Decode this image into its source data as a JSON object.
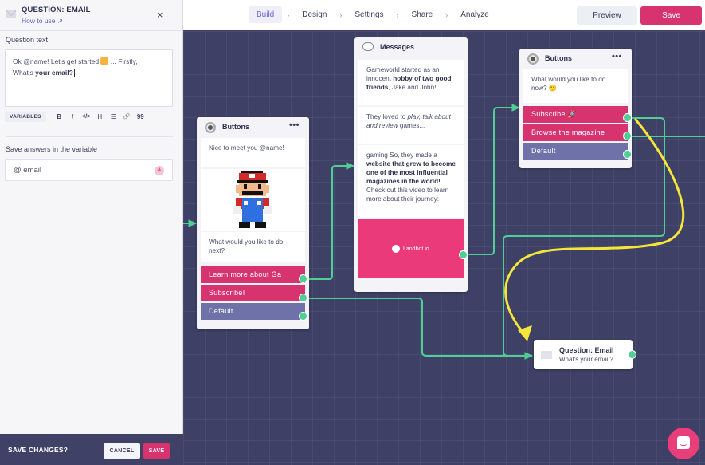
{
  "topbar": {
    "steps": [
      {
        "label": "Build",
        "active": true
      },
      {
        "label": "Design",
        "active": false
      },
      {
        "label": "Settings",
        "active": false
      },
      {
        "label": "Share",
        "active": false
      },
      {
        "label": "Analyze",
        "active": false
      }
    ],
    "step_separator": "›",
    "preview_label": "Preview",
    "save_label": "Save"
  },
  "panel": {
    "title": "QUESTION: EMAIL",
    "how_to_use": "How to use ↗",
    "close_icon": "×",
    "question_text_label": "Question text",
    "question_text": {
      "line1_pre": "Ok @name! Let's get started ",
      "line1_post": " ... Firstly,",
      "line2_pre": "What's ",
      "line2_bold": "your email?"
    },
    "toolbar": {
      "variables": "VARIABLES",
      "bold": "B",
      "italic": "I",
      "code": "</>",
      "heading": "H",
      "list": "☰",
      "link": "🔗",
      "quote": "99"
    },
    "save_variable_label": "Save answers in the variable",
    "variable_value": "@ email",
    "variable_badge": "A"
  },
  "savebar": {
    "label": "SAVE CHANGES?",
    "cancel": "CANCEL",
    "save": "SAVE"
  },
  "canvas": {
    "buttons_card_1": {
      "title": "Buttons",
      "menu": "•••",
      "bubble1": "Nice to meet you @name!",
      "bubble2": "What would you like to do next?",
      "options": [
        "Learn more about Ga",
        "Subscribe!",
        "Default"
      ]
    },
    "messages_card": {
      "title": "Messages",
      "msg1": {
        "pre": "Gameworld started as an innocent ",
        "bold": "hobby of two good friends",
        "post": ", Jake and John!"
      },
      "msg2": {
        "pre": "They loved to ",
        "italic": "play, talk about and review",
        "post": " games..."
      },
      "msg3": {
        "pre": "gaming So, they made a ",
        "bold": "website that grew to become one of the most influential magazines in the world!",
        "post": " Check out this video to learn more about their journey:"
      },
      "video_logo": "Landbot.io"
    },
    "buttons_card_2": {
      "title": "Buttons",
      "menu": "•••",
      "bubble": "What would you like to do now? 🙂",
      "options": [
        "Subscribe 🚀",
        "Browse the magazine",
        "Default"
      ]
    },
    "question_node": {
      "title": "Question: Email",
      "subtitle": "What's your email?"
    },
    "colors": {
      "canvas_bg": "#3e4165",
      "option_pink": "#d6336f",
      "option_default": "#6e72a8",
      "connector": "#4fcf94",
      "annotation_arrow": "#f5e63a"
    }
  }
}
